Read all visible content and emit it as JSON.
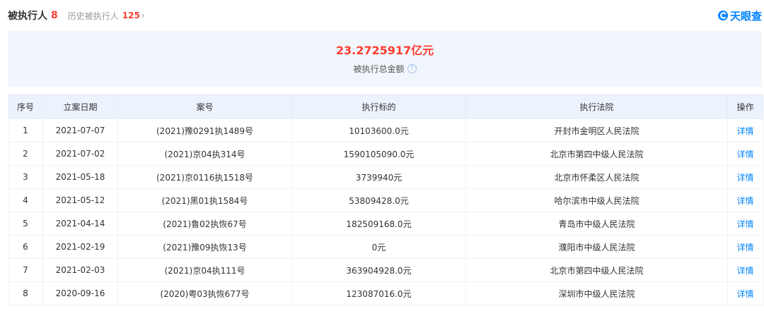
{
  "header": {
    "title": "被执行人",
    "count": "8",
    "history_label": "历史被执行人",
    "history_count": "125",
    "history_arrow": "›",
    "logo_text": "天眼查"
  },
  "summary": {
    "total_amount": "23.2725917亿元",
    "total_label": "被执行总金额",
    "help_glyph": "?"
  },
  "table": {
    "columns": [
      "序号",
      "立案日期",
      "案号",
      "执行标的",
      "执行法院",
      "操作"
    ],
    "rows": [
      {
        "no": "1",
        "date": "2021-07-07",
        "case_no": "(2021)豫0291执1489号",
        "amount": "10103600.0元",
        "court": "开封市金明区人民法院",
        "action": "详情"
      },
      {
        "no": "2",
        "date": "2021-07-02",
        "case_no": "(2021)京04执314号",
        "amount": "1590105090.0元",
        "court": "北京市第四中级人民法院",
        "action": "详情"
      },
      {
        "no": "3",
        "date": "2021-05-18",
        "case_no": "(2021)京0116执1518号",
        "amount": "3739940元",
        "court": "北京市怀柔区人民法院",
        "action": "详情"
      },
      {
        "no": "4",
        "date": "2021-05-12",
        "case_no": "(2021)黑01执1584号",
        "amount": "53809428.0元",
        "court": "哈尔滨市中级人民法院",
        "action": "详情"
      },
      {
        "no": "5",
        "date": "2021-04-14",
        "case_no": "(2021)鲁02执恢67号",
        "amount": "182509168.0元",
        "court": "青岛市中级人民法院",
        "action": "详情"
      },
      {
        "no": "6",
        "date": "2021-02-19",
        "case_no": "(2021)豫09执恢13号",
        "amount": "0元",
        "court": "濮阳市中级人民法院",
        "action": "详情"
      },
      {
        "no": "7",
        "date": "2021-02-03",
        "case_no": "(2021)京04执111号",
        "amount": "363904928.0元",
        "court": "北京市第四中级人民法院",
        "action": "详情"
      },
      {
        "no": "8",
        "date": "2020-09-16",
        "case_no": "(2020)粤03执恢677号",
        "amount": "123087016.0元",
        "court": "深圳市中级人民法院",
        "action": "详情"
      }
    ]
  },
  "colors": {
    "accent_red": "#ff3b30",
    "link_blue": "#0084ff",
    "summary_bg": "#f1f6fc",
    "header_bg": "#edf3fc"
  },
  "icons": {
    "logo": "tianyancha-logo-icon",
    "help": "help-circle-icon",
    "arrow": "chevron-right-icon"
  }
}
